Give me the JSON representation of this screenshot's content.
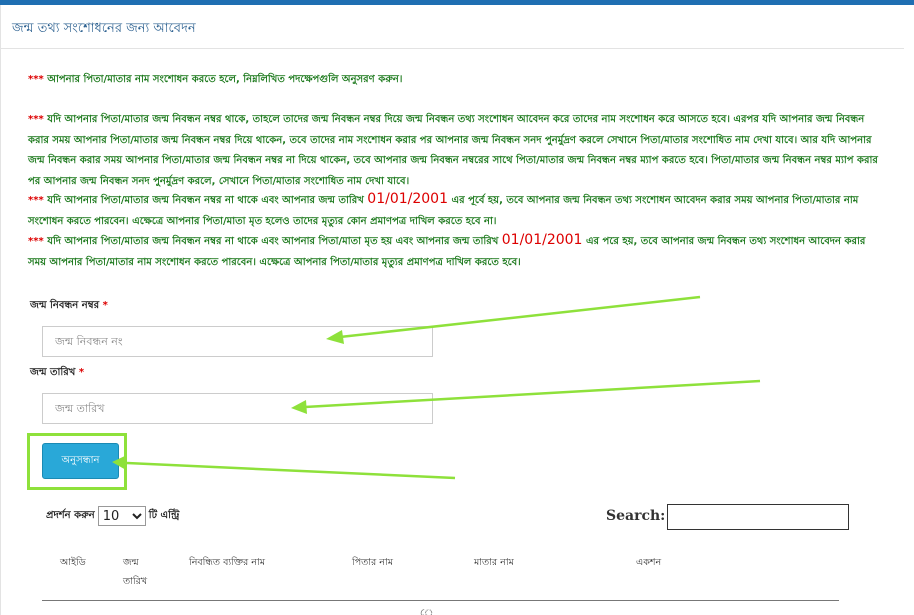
{
  "page": {
    "title": "জন্ম তথ্য সংশোধনের জন্য আবেদন"
  },
  "notices": [
    {
      "stars": "***",
      "text": "আপনার পিতা/মাতার নাম সংশোধন করতে হলে, নিম্নলিখিত পদক্ষেপগুলি অনুসরণ করুন।"
    },
    {
      "stars": "***",
      "text": "যদি আপনার পিতা/মাতার জন্ম নিবন্ধন নম্বর থাকে, তাহলে তাদের জন্ম নিবন্ধন নম্বর দিয়ে জন্ম নিবন্ধন তথ্য সংশোধন আবেদন করে তাদের নাম সংশোধন করে আসতে হবে। এরপর যদি আপনার জন্ম নিবন্ধন করার সময় আপনার পিতা/মাতার জন্ম নিবন্ধন নম্বর দিয়ে থাকেন, তবে তাদের নাম সংশোধন করার পর আপনার জন্ম নিবন্ধন সনদ পুনর্মুদ্রণ করলে সেখানে পিতা/মাতার সংশোধিত নাম দেখা যাবে। আর যদি আপনার জন্ম নিবন্ধন করার সময় আপনার পিতা/মাতার জন্ম নিবন্ধন নম্বর না দিয়ে থাকেন, তবে আপনার জন্ম নিবন্ধন নম্বরের সাথে পিতা/মাতার জন্ম নিবন্ধন নম্বর ম্যাপ করতে হবে। পিতা/মাতার জন্ম নিবন্ধন নম্বর ম্যাপ করার পর আপনার জন্ম নিবন্ধন সনদ পুনর্মুদ্রণ করলে, সেখানে পিতা/মাতার সংশোধিত নাম দেখা যাবে।"
    },
    {
      "stars": "***",
      "text_before": "যদি আপনার পিতা/মাতার জন্ম নিবন্ধন নম্বর না থাকে এবং আপনার জন্ম তারিখ",
      "date": "01/01/2001",
      "text_after": "এর পূর্বে হয়, তবে আপনার জন্ম নিবন্ধন তথ্য সংশোধন আবেদন করার সময় আপনার পিতা/মাতার নাম সংশোধন করতে পারবেন। এক্ষেত্রে আপনার পিতা/মাতা মৃত হলেও তাদের মৃত্যুর কোন প্রমাণপত্র দাখিল করতে হবে না।"
    },
    {
      "stars": "***",
      "text_before": "যদি আপনার পিতা/মাতার জন্ম নিবন্ধন নম্বর না থাকে এবং আপনার পিতা/মাতা মৃত হয় এবং আপনার জন্ম তারিখ",
      "date": "01/01/2001",
      "text_after": "এর পরে হয়, তবে আপনার জন্ম নিবন্ধন তথ্য সংশোধন আবেদন করার সময় আপনার পিতা/মাতার নাম সংশোধন করতে পারবেন। এক্ষেত্রে আপনার পিতা/মাতার মৃত্যুর প্রমাণপত্র দাখিল করতে হবে।"
    }
  ],
  "form": {
    "brn_label": "জন্ম নিবন্ধন নম্বর",
    "brn_placeholder": "জন্ম নিবন্ধন নং",
    "dob_label": "জন্ম তারিখ",
    "dob_placeholder": "জন্ম তারিখ",
    "required_mark": "*",
    "search_button": "অনুসন্ধান"
  },
  "table_controls": {
    "show_label": "প্রদর্শন করুন",
    "page_size": "10",
    "entries_label": "টি এন্ট্রি",
    "search_label": "Search:"
  },
  "table": {
    "headers": [
      "আইডি",
      "জন্ম তারিখ",
      "নিবন্ধিত ব্যক্তির নাম",
      "পিতার নাম",
      "মাতার নাম",
      "একশন"
    ],
    "partial_row_text": "ে"
  },
  "colors": {
    "annotation_arrow": "#8ee13b",
    "notice_text": "#1e7a1e",
    "notice_marker": "#dd0000",
    "button": "#29a8d8",
    "header_bar": "#1f6fb2"
  }
}
